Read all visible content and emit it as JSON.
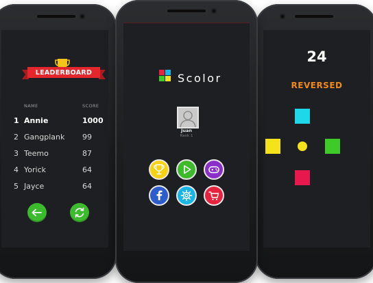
{
  "leaderboard": {
    "banner": "LEADERBOARD",
    "col_name": "NAME",
    "col_score": "SCORE",
    "rows": [
      {
        "rank": "1",
        "name": "Annie",
        "score": "1000"
      },
      {
        "rank": "2",
        "name": "Gangplank",
        "score": "99"
      },
      {
        "rank": "3",
        "name": "Teemo",
        "score": "87"
      },
      {
        "rank": "4",
        "name": "Yorick",
        "score": "64"
      },
      {
        "rank": "5",
        "name": "Jayce",
        "score": "64"
      }
    ]
  },
  "home": {
    "logo_text": "Scolor",
    "player_name": "Juan",
    "player_rank": "Rank 1"
  },
  "game": {
    "counter": "24",
    "mode": "REVERSED"
  },
  "colors": {
    "ribbon": "#e3272c",
    "trophy": "#f6c319",
    "green": "#3dbb2e",
    "play_green": "#3fba2c",
    "leaderboard_yellow": "#f6d212",
    "purple": "#8b2fc9",
    "facebook_blue": "#2d5ccb",
    "settings_cyan": "#17b6e6",
    "store_red": "#e7243f",
    "game_cyan": "#1ed8ea",
    "game_yellow": "#f4e21b",
    "game_green": "#3ecb2a",
    "game_red": "#e6184e",
    "orange_text": "#f08a1c"
  }
}
